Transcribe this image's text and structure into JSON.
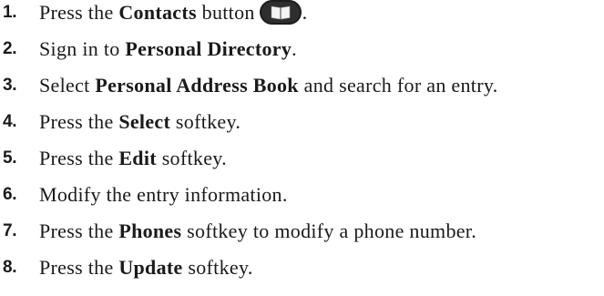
{
  "steps": [
    {
      "number": "1.",
      "text_before": "Press the ",
      "bold": "Contacts",
      "text_after": " button",
      "icon": "contacts-book-icon",
      "trailing": "."
    },
    {
      "number": "2.",
      "text_before": "Sign in to ",
      "bold": "Personal Directory",
      "text_after": "."
    },
    {
      "number": "3.",
      "text_before": "Select ",
      "bold": "Personal Address Book",
      "text_after": " and search for an entry."
    },
    {
      "number": "4.",
      "text_before": "Press the ",
      "bold": "Select",
      "text_after": " softkey."
    },
    {
      "number": "5.",
      "text_before": "Press the ",
      "bold": "Edit",
      "text_after": " softkey."
    },
    {
      "number": "6.",
      "text_before": "Modify the entry information.",
      "bold": "",
      "text_after": ""
    },
    {
      "number": "7.",
      "text_before": "Press the ",
      "bold": "Phones",
      "text_after": " softkey to modify a phone number."
    },
    {
      "number": "8.",
      "text_before": "Press the ",
      "bold": "Update",
      "text_after": " softkey."
    }
  ]
}
